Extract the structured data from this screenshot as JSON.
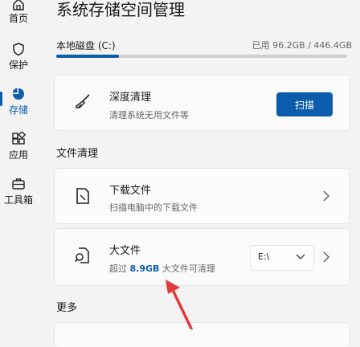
{
  "sidebar": {
    "items": [
      {
        "label": "首页",
        "icon": "home-icon"
      },
      {
        "label": "保护",
        "icon": "shield-icon"
      },
      {
        "label": "存储",
        "icon": "pie-chart-icon",
        "active": true
      },
      {
        "label": "应用",
        "icon": "apps-icon"
      },
      {
        "label": "工具箱",
        "icon": "toolbox-icon"
      }
    ]
  },
  "header": {
    "title": "系统存储空间管理"
  },
  "disk": {
    "label": "本地磁盘 (C:)",
    "usage": "已用 96.2GB / 446.4GB",
    "used_fraction": 0.216
  },
  "deep_clean": {
    "title": "深度清理",
    "desc": "清理系统无用文件等",
    "button": "扫描",
    "icon": "broom-icon"
  },
  "file_clean": {
    "section": "文件清理"
  },
  "downloads": {
    "title": "下载文件",
    "desc": "扫描电脑中的下载文件",
    "icon": "document-icon"
  },
  "large_files": {
    "title": "大文件",
    "desc_prefix": "超过 ",
    "desc_size": "8.9GB",
    "desc_suffix": " 大文件可清理",
    "drive": "E:\\",
    "icon": "file-search-icon"
  },
  "more": {
    "section": "更多"
  },
  "colors": {
    "accent": "#0b5cad",
    "annotation_arrow": "#e03a3a"
  }
}
